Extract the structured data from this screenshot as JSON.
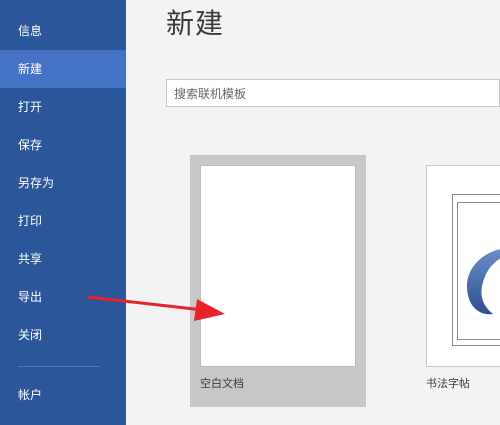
{
  "sidebar": {
    "items": [
      {
        "label": "信息"
      },
      {
        "label": "新建"
      },
      {
        "label": "打开"
      },
      {
        "label": "保存"
      },
      {
        "label": "另存为"
      },
      {
        "label": "打印"
      },
      {
        "label": "共享"
      },
      {
        "label": "导出"
      },
      {
        "label": "关闭"
      },
      {
        "label": "帐户"
      }
    ],
    "active": "新建"
  },
  "main": {
    "title": "新建",
    "search": {
      "placeholder": "搜索联机模板",
      "value": ""
    },
    "templates": [
      {
        "label": "空白文档"
      },
      {
        "label": "书法字帖"
      }
    ]
  },
  "colors": {
    "sidebar_bg": "#2b579a",
    "sidebar_active": "#4472c4",
    "arrow": "#e8232a"
  }
}
